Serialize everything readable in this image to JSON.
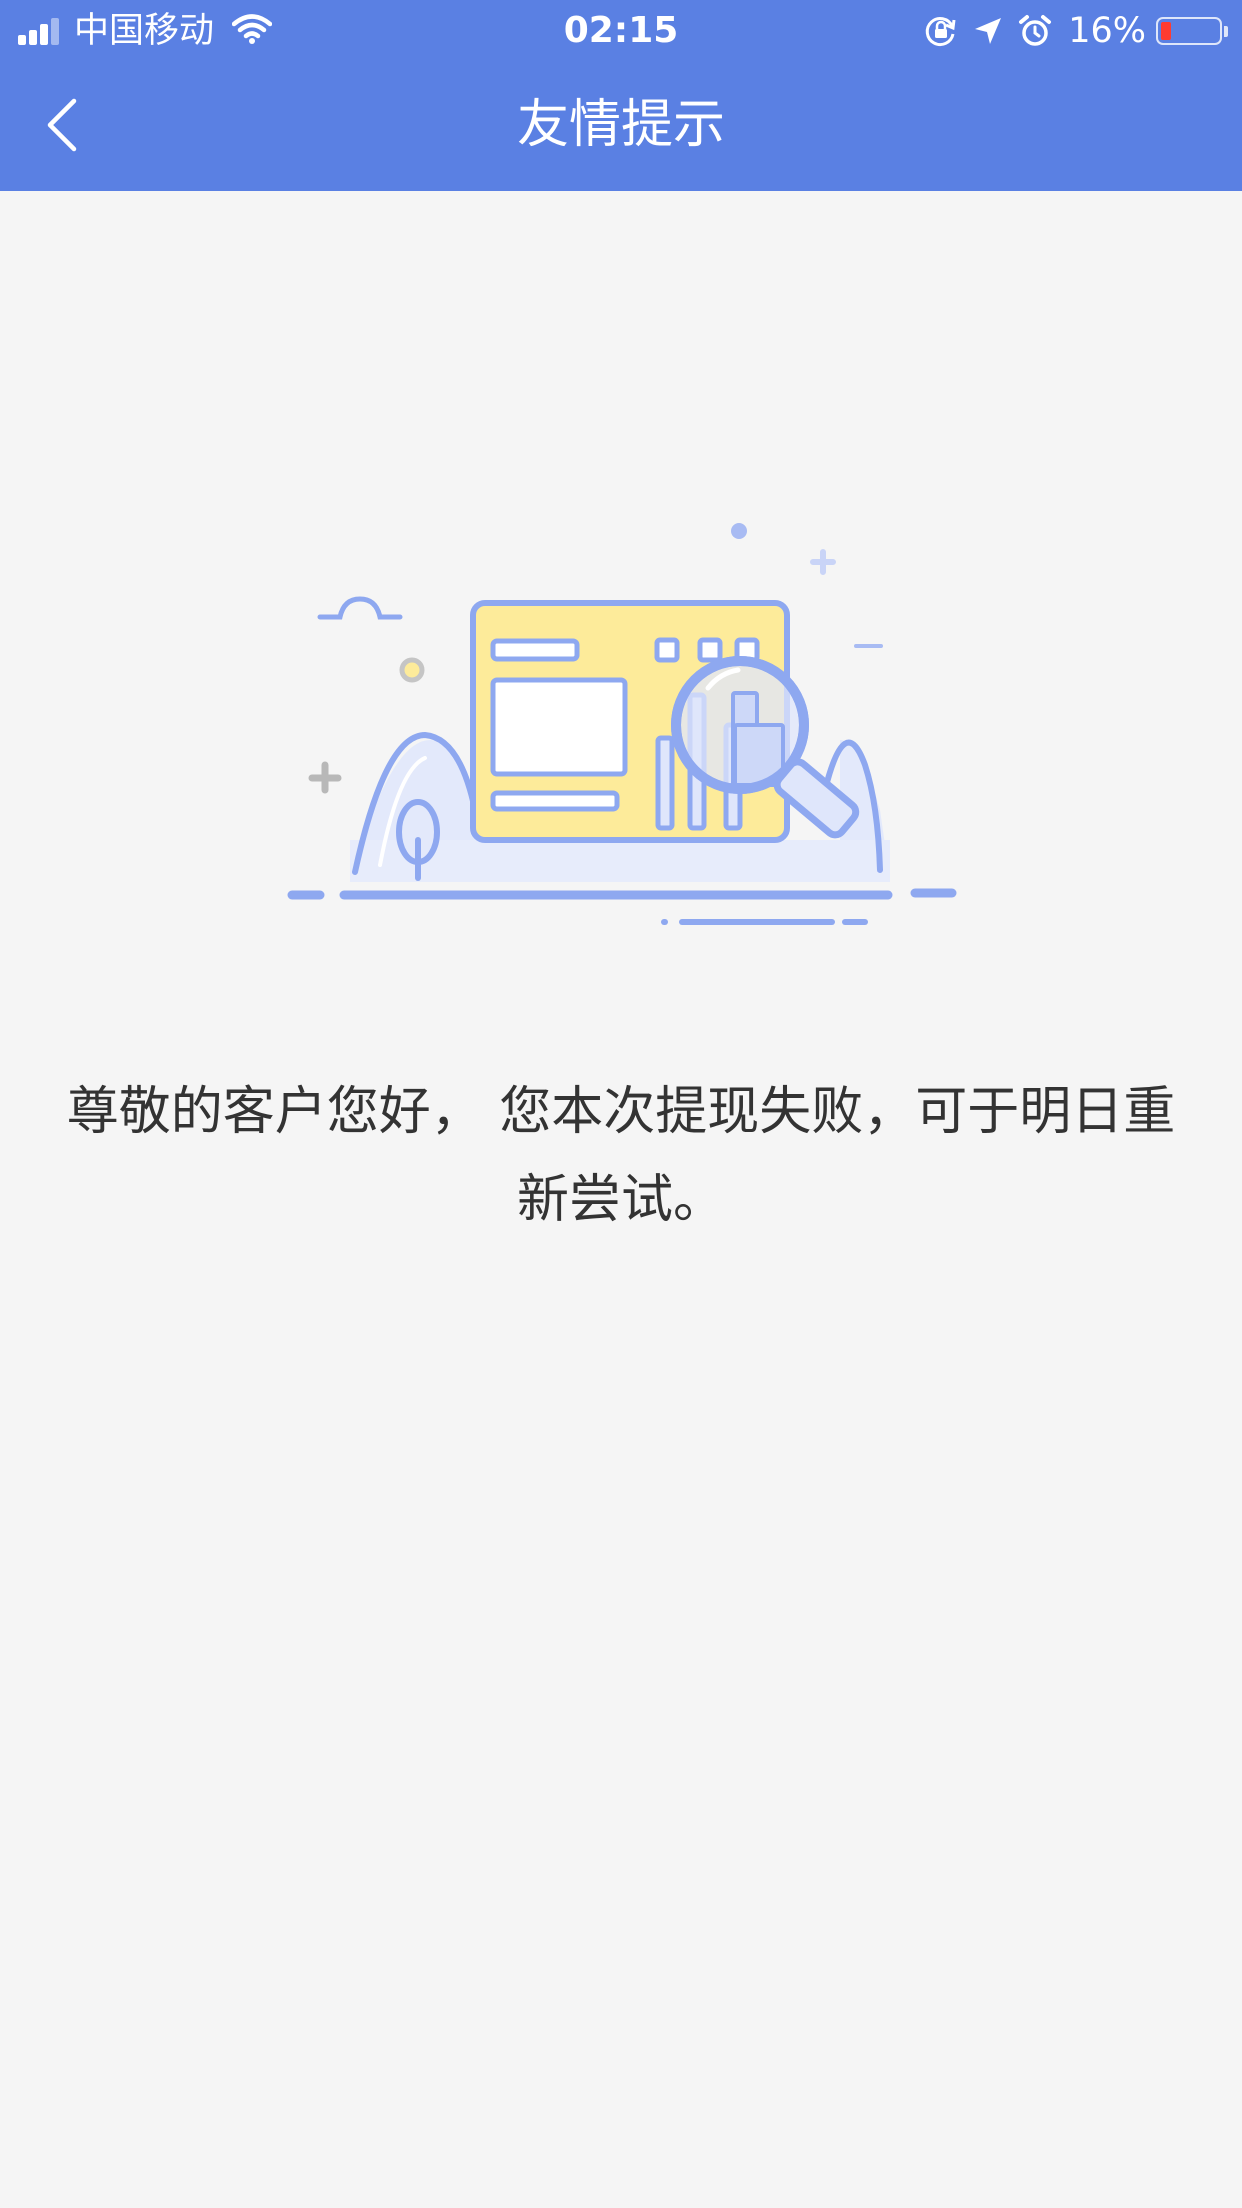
{
  "status_bar": {
    "carrier": "中国移动",
    "time": "02:15",
    "battery_percent": "16%",
    "icons": [
      "signal-icon",
      "wifi-icon",
      "rotation-lock-icon",
      "location-icon",
      "alarm-icon",
      "battery-icon"
    ]
  },
  "nav": {
    "title": "友情提示",
    "back_icon": "chevron-left-icon"
  },
  "content": {
    "illustration": "empty-state-illustration",
    "message": "尊敬的客户您好， 您本次提现失败，可于明日重新尝试。"
  },
  "colors": {
    "header_bg": "#5a80e3",
    "page_bg": "#f5f5f5",
    "text": "#333333",
    "illustration_blue": "#8ea8f0",
    "illustration_yellow": "#fdeb9a",
    "battery_low": "#ff3b30"
  }
}
